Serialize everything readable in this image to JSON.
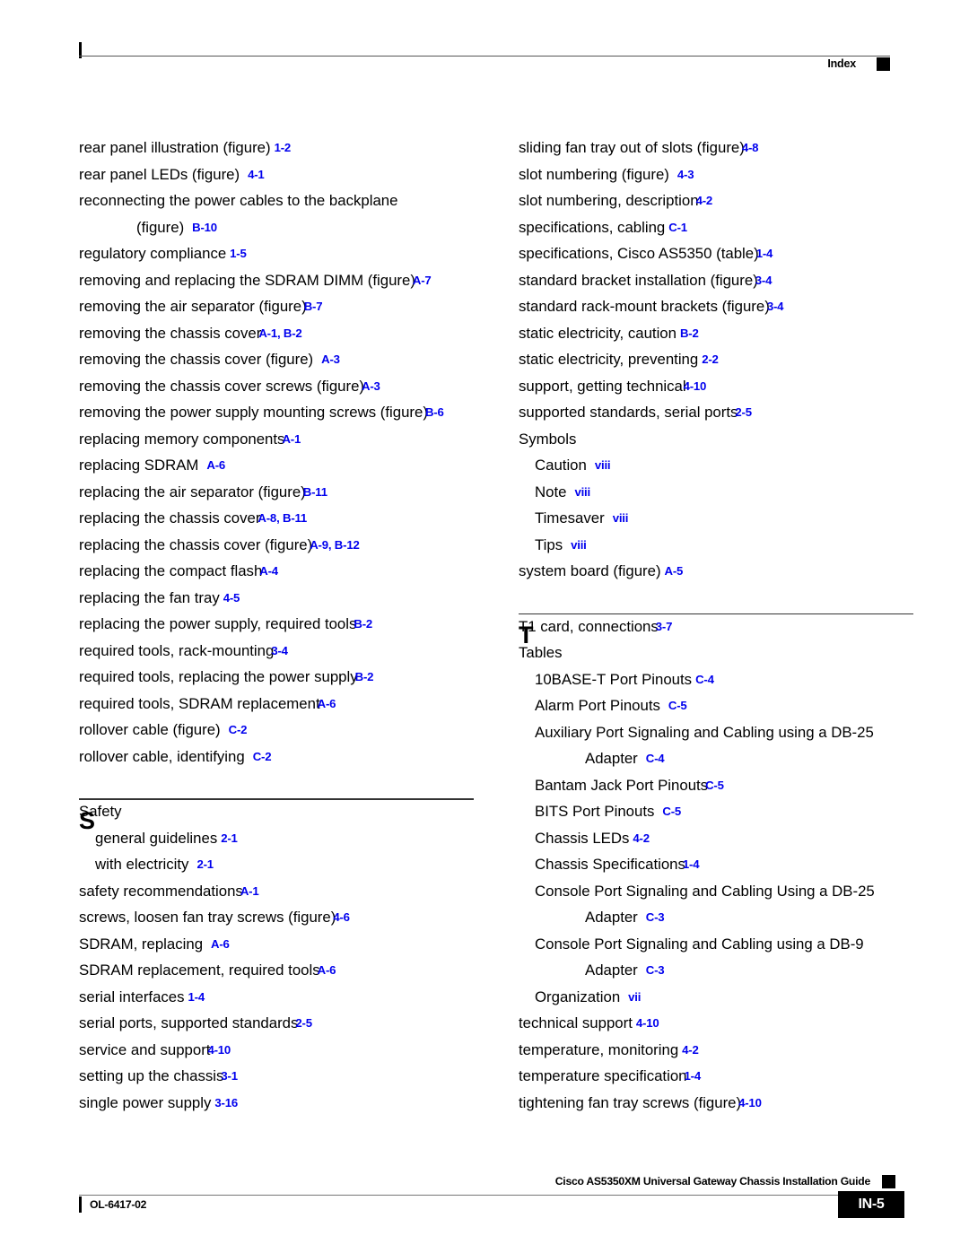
{
  "header": {
    "label": "Index",
    "marker_icon": "black-square"
  },
  "footer": {
    "guide_title": "Cisco AS5350XM Universal Gateway Chassis Installation Guide",
    "doc_id": "OL-6417-02",
    "page_number": "IN-5",
    "marker_icon": "black-square"
  },
  "accent_color": "#0000ee",
  "columns": {
    "left": [
      {
        "kind": "entry",
        "level": 1,
        "text": "rear panel illustration (figure)",
        "page": "1-2",
        "spacing": "sm"
      },
      {
        "kind": "entry",
        "level": 1,
        "text": "rear panel LEDs (figure)",
        "page": "4-1",
        "spacing": "md"
      },
      {
        "kind": "entry",
        "level": 1,
        "text": "reconnecting the power cables to the backplane",
        "page": "",
        "spacing": "none"
      },
      {
        "kind": "cont",
        "level": 1,
        "text": "(figure)",
        "page": "B-10",
        "spacing": "md"
      },
      {
        "kind": "entry",
        "level": 1,
        "text": "regulatory compliance",
        "page": "1-5",
        "spacing": "sm"
      },
      {
        "kind": "entry",
        "level": 1,
        "text": "removing and replacing the SDRAM DIMM (figure)",
        "page": "A-7",
        "spacing": "tight"
      },
      {
        "kind": "entry",
        "level": 1,
        "text": "removing the air separator (figure)",
        "page": "B-7",
        "spacing": "tight"
      },
      {
        "kind": "entry",
        "level": 1,
        "text": "removing the chassis cover",
        "page": "A-1, B-2",
        "spacing": "tight"
      },
      {
        "kind": "entry",
        "level": 1,
        "text": "removing the chassis cover (figure)",
        "page": "A-3",
        "spacing": "md"
      },
      {
        "kind": "entry",
        "level": 1,
        "text": "removing the chassis cover screws (figure)",
        "page": "A-3",
        "spacing": "tight"
      },
      {
        "kind": "entry",
        "level": 1,
        "text": "removing the power supply mounting screws (figure)",
        "page": "B-6",
        "spacing": "tight"
      },
      {
        "kind": "entry",
        "level": 1,
        "text": "replacing memory components",
        "page": "A-1",
        "spacing": "tight"
      },
      {
        "kind": "entry",
        "level": 1,
        "text": "replacing SDRAM",
        "page": "A-6",
        "spacing": "md"
      },
      {
        "kind": "entry",
        "level": 1,
        "text": "replacing the air separator (figure)",
        "page": "B-11",
        "spacing": "tight"
      },
      {
        "kind": "entry",
        "level": 1,
        "text": "replacing the chassis cover",
        "page": "A-8, B-11",
        "spacing": "tight"
      },
      {
        "kind": "entry",
        "level": 1,
        "text": "replacing the chassis cover (figure)",
        "page": "A-9, B-12",
        "spacing": "tight"
      },
      {
        "kind": "entry",
        "level": 1,
        "text": "replacing the compact flash",
        "page": "A-4",
        "spacing": "tight"
      },
      {
        "kind": "entry",
        "level": 1,
        "text": "replacing the fan tray",
        "page": "4-5",
        "spacing": "sm"
      },
      {
        "kind": "entry",
        "level": 1,
        "text": "replacing the power supply, required tools",
        "page": "B-2",
        "spacing": "tight"
      },
      {
        "kind": "entry",
        "level": 1,
        "text": "required tools, rack-mounting",
        "page": "3-4",
        "spacing": "tight"
      },
      {
        "kind": "entry",
        "level": 1,
        "text": "required tools, replacing the power supply",
        "page": "B-2",
        "spacing": "tight"
      },
      {
        "kind": "entry",
        "level": 1,
        "text": "required tools, SDRAM replacement",
        "page": "A-6",
        "spacing": "tight"
      },
      {
        "kind": "entry",
        "level": 1,
        "text": "rollover cable (figure)",
        "page": "C-2",
        "spacing": "md"
      },
      {
        "kind": "entry",
        "level": 1,
        "text": "rollover cable, identifying",
        "page": "C-2",
        "spacing": "md"
      },
      {
        "kind": "section",
        "letter": "S"
      },
      {
        "kind": "entry",
        "level": 1,
        "text": "Safety",
        "page": "",
        "spacing": "none"
      },
      {
        "kind": "entry",
        "level": 2,
        "text": "general guidelines",
        "page": "2-1",
        "spacing": "sm"
      },
      {
        "kind": "entry",
        "level": 2,
        "text": "with electricity",
        "page": "2-1",
        "spacing": "md"
      },
      {
        "kind": "entry",
        "level": 1,
        "text": "safety recommendations",
        "page": "A-1",
        "spacing": "tight"
      },
      {
        "kind": "entry",
        "level": 1,
        "text": "screws, loosen fan tray screws (figure)",
        "page": "4-6",
        "spacing": "tight"
      },
      {
        "kind": "entry",
        "level": 1,
        "text": "SDRAM, replacing",
        "page": "A-6",
        "spacing": "md"
      },
      {
        "kind": "entry",
        "level": 1,
        "text": "SDRAM replacement, required tools",
        "page": "A-6",
        "spacing": "tight"
      },
      {
        "kind": "entry",
        "level": 1,
        "text": "serial interfaces",
        "page": "1-4",
        "spacing": "sm"
      },
      {
        "kind": "entry",
        "level": 1,
        "text": "serial ports, supported standards",
        "page": "2-5",
        "spacing": "tight"
      },
      {
        "kind": "entry",
        "level": 1,
        "text": "service and support",
        "page": "4-10",
        "spacing": "tight"
      },
      {
        "kind": "entry",
        "level": 1,
        "text": "setting up the chassis",
        "page": "3-1",
        "spacing": "tight"
      },
      {
        "kind": "entry",
        "level": 1,
        "text": "single power supply",
        "page": "3-16",
        "spacing": "sm"
      }
    ],
    "right": [
      {
        "kind": "entry",
        "level": 1,
        "text": "sliding fan tray out of slots (figure)",
        "page": "4-8",
        "spacing": "tight"
      },
      {
        "kind": "entry",
        "level": 1,
        "text": "slot numbering (figure)",
        "page": "4-3",
        "spacing": "md"
      },
      {
        "kind": "entry",
        "level": 1,
        "text": "slot numbering, description",
        "page": "4-2",
        "spacing": "tight"
      },
      {
        "kind": "entry",
        "level": 1,
        "text": "specifications, cabling",
        "page": "C-1",
        "spacing": "sm"
      },
      {
        "kind": "entry",
        "level": 1,
        "text": "specifications, Cisco AS5350 (table)",
        "page": "1-4",
        "spacing": "tight"
      },
      {
        "kind": "entry",
        "level": 1,
        "text": "standard bracket installation (figure)",
        "page": "3-4",
        "spacing": "tight"
      },
      {
        "kind": "entry",
        "level": 1,
        "text": "standard rack-mount brackets (figure)",
        "page": "3-4",
        "spacing": "tight"
      },
      {
        "kind": "entry",
        "level": 1,
        "text": "static electricity, caution",
        "page": "B-2",
        "spacing": "sm"
      },
      {
        "kind": "entry",
        "level": 1,
        "text": "static electricity, preventing",
        "page": "2-2",
        "spacing": "sm"
      },
      {
        "kind": "entry",
        "level": 1,
        "text": "support, getting technical",
        "page": "4-10",
        "spacing": "tight"
      },
      {
        "kind": "entry",
        "level": 1,
        "text": "supported standards, serial ports",
        "page": "2-5",
        "spacing": "tight"
      },
      {
        "kind": "entry",
        "level": 1,
        "text": "Symbols",
        "page": "",
        "spacing": "none"
      },
      {
        "kind": "entry",
        "level": 2,
        "text": "Caution",
        "page": "viii",
        "spacing": "md"
      },
      {
        "kind": "entry",
        "level": 2,
        "text": "Note",
        "page": "viii",
        "spacing": "md"
      },
      {
        "kind": "entry",
        "level": 2,
        "text": "Timesaver",
        "page": "viii",
        "spacing": "md"
      },
      {
        "kind": "entry",
        "level": 2,
        "text": "Tips",
        "page": "viii",
        "spacing": "md"
      },
      {
        "kind": "entry",
        "level": 1,
        "text": "system board (figure)",
        "page": "A-5",
        "spacing": "sm"
      },
      {
        "kind": "section",
        "letter": "T"
      },
      {
        "kind": "entry",
        "level": 1,
        "text": "T1 card, connections",
        "page": "3-7",
        "spacing": "tight"
      },
      {
        "kind": "entry",
        "level": 1,
        "text": "Tables",
        "page": "",
        "spacing": "none"
      },
      {
        "kind": "entry",
        "level": 2,
        "text": "10BASE-T Port Pinouts",
        "page": "C-4",
        "spacing": "sm"
      },
      {
        "kind": "entry",
        "level": 2,
        "text": "Alarm Port Pinouts",
        "page": "C-5",
        "spacing": "md"
      },
      {
        "kind": "entry",
        "level": 2,
        "text": "Auxiliary Port Signaling and Cabling using a DB-25",
        "page": "",
        "spacing": "none"
      },
      {
        "kind": "cont",
        "level": 2,
        "text": "Adapter",
        "page": "C-4",
        "spacing": "md"
      },
      {
        "kind": "entry",
        "level": 2,
        "text": "Bantam Jack Port Pinouts",
        "page": "C-5",
        "spacing": "tight"
      },
      {
        "kind": "entry",
        "level": 2,
        "text": "BITS Port Pinouts",
        "page": "C-5",
        "spacing": "md"
      },
      {
        "kind": "entry",
        "level": 2,
        "text": "Chassis LEDs",
        "page": "4-2",
        "spacing": "sm"
      },
      {
        "kind": "entry",
        "level": 2,
        "text": "Chassis Specifications",
        "page": "1-4",
        "spacing": "tight"
      },
      {
        "kind": "entry",
        "level": 2,
        "text": "Console Port Signaling and Cabling Using a DB-25",
        "page": "",
        "spacing": "none"
      },
      {
        "kind": "cont",
        "level": 2,
        "text": "Adapter",
        "page": "C-3",
        "spacing": "md"
      },
      {
        "kind": "entry",
        "level": 2,
        "text": "Console Port Signaling and Cabling using a DB-9",
        "page": "",
        "spacing": "none"
      },
      {
        "kind": "cont",
        "level": 2,
        "text": "Adapter",
        "page": "C-3",
        "spacing": "md"
      },
      {
        "kind": "entry",
        "level": 2,
        "text": "Organization",
        "page": "vii",
        "spacing": "md"
      },
      {
        "kind": "entry",
        "level": 1,
        "text": "technical support",
        "page": "4-10",
        "spacing": "sm"
      },
      {
        "kind": "entry",
        "level": 1,
        "text": "temperature, monitoring",
        "page": "4-2",
        "spacing": "sm"
      },
      {
        "kind": "entry",
        "level": 1,
        "text": "temperature specification",
        "page": "1-4",
        "spacing": "tight"
      },
      {
        "kind": "entry",
        "level": 1,
        "text": "tightening fan tray screws (figure)",
        "page": "4-10",
        "spacing": "tight"
      }
    ]
  }
}
